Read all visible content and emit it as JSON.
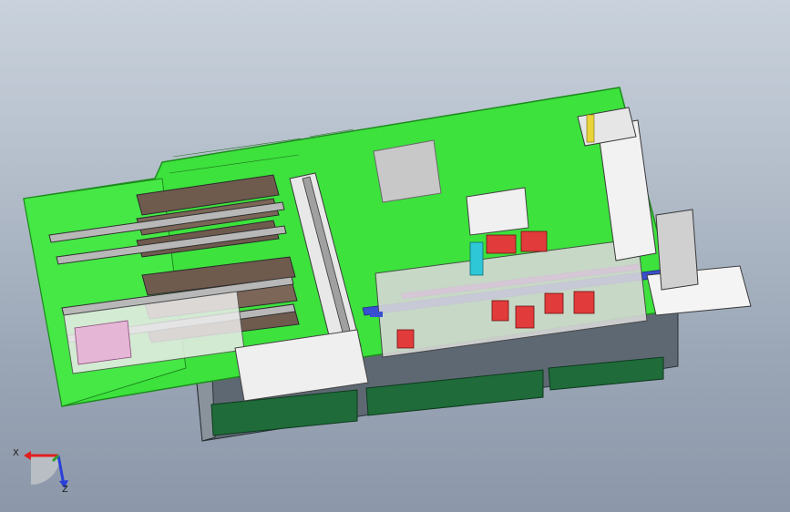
{
  "viewport": {
    "background_top": "#c9d2dc",
    "background_bottom": "#8c98a9"
  },
  "model": {
    "description_colors": {
      "base_plate": "#3de23d",
      "plate_edge": "#1e8a1e",
      "cabinet": "#5a6470",
      "cabinet_panel": "#1f6b3a",
      "rail": "#8c8c8c",
      "highlight_part": "#e23b3b",
      "accent_blue": "#3a4fd0",
      "accent_cyan": "#2ec7d8",
      "accent_magenta": "#c43ac4",
      "white_part": "#f0f0f0",
      "dark_part": "#3a3a3a"
    }
  },
  "triad": {
    "x_label": "X",
    "z_label": "Z",
    "x_color": "#e02020",
    "z_color": "#2a40d8",
    "y_color": "#30a030"
  }
}
